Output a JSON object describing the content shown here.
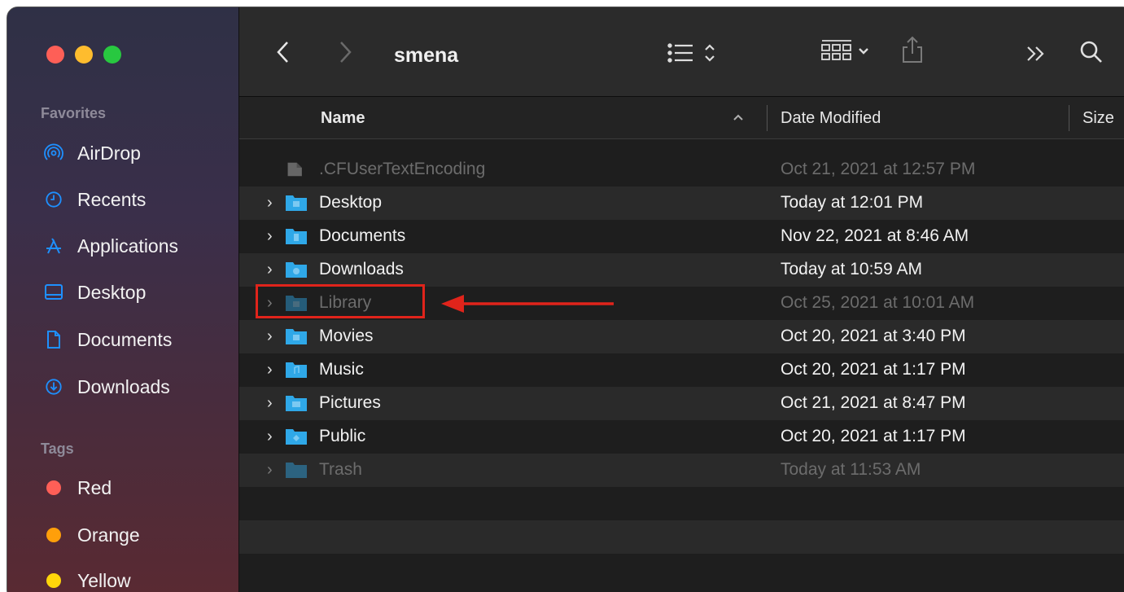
{
  "window": {
    "title": "smena"
  },
  "sidebar": {
    "favorites_title": "Favorites",
    "favorites": [
      {
        "label": "AirDrop",
        "icon": "airdrop-icon"
      },
      {
        "label": "Recents",
        "icon": "clock-icon"
      },
      {
        "label": "Applications",
        "icon": "applications-icon"
      },
      {
        "label": "Desktop",
        "icon": "desktop-icon"
      },
      {
        "label": "Documents",
        "icon": "document-icon"
      },
      {
        "label": "Downloads",
        "icon": "download-icon"
      }
    ],
    "tags_title": "Tags",
    "tags": [
      {
        "label": "Red",
        "color": "#fe5f57"
      },
      {
        "label": "Orange",
        "color": "#ff9f0a"
      },
      {
        "label": "Yellow",
        "color": "#ffd60a"
      }
    ]
  },
  "columns": {
    "name": "Name",
    "date_modified": "Date Modified",
    "size": "Size"
  },
  "files": [
    {
      "name": ".CFUserTextEncoding",
      "date": "Oct 21, 2021 at 12:57 PM",
      "type": "file",
      "dim": true
    },
    {
      "name": "Desktop",
      "date": "Today at 12:01 PM",
      "type": "folder",
      "dim": false
    },
    {
      "name": "Documents",
      "date": "Nov 22, 2021 at 8:46 AM",
      "type": "folder",
      "dim": false
    },
    {
      "name": "Downloads",
      "date": "Today at 10:59 AM",
      "type": "folder",
      "dim": false
    },
    {
      "name": "Library",
      "date": "Oct 25, 2021 at 10:01 AM",
      "type": "folder",
      "dim": true
    },
    {
      "name": "Movies",
      "date": "Oct 20, 2021 at 3:40 PM",
      "type": "folder",
      "dim": false
    },
    {
      "name": "Music",
      "date": "Oct 20, 2021 at 1:17 PM",
      "type": "folder",
      "dim": false
    },
    {
      "name": "Pictures",
      "date": "Oct 21, 2021 at 8:47 PM",
      "type": "folder",
      "dim": false
    },
    {
      "name": "Public",
      "date": "Oct 20, 2021 at 1:17 PM",
      "type": "folder",
      "dim": false
    },
    {
      "name": "Trash",
      "date": "Today at 11:53 AM",
      "type": "folder",
      "dim": true
    }
  ],
  "colors": {
    "folder": "#2fa8e8",
    "annotation": "#e0241b"
  }
}
